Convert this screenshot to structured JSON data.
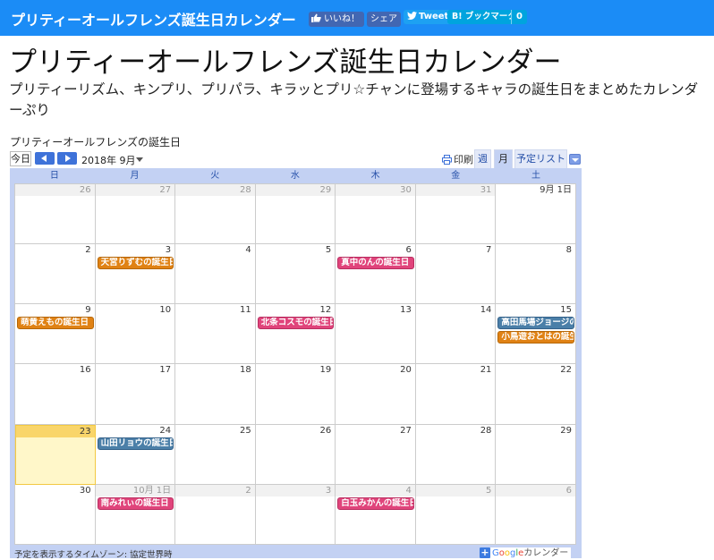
{
  "topbar": {
    "site_title": "プリティーオールフレンズ誕生日カレンダー",
    "like_label": "いいね！",
    "share_label": "シェア",
    "tweet_label": "Tweet",
    "hatena_label": "B! ブックマーク",
    "hatena_count": "0",
    "bar_color": "#1b8cf6"
  },
  "page": {
    "title": "プリティーオールフレンズ誕生日カレンダー",
    "description": "プリティーリズム、キンプリ、プリパラ、キラッとプリ☆チャンに登場するキャラの誕生日をまとめたカレンダーぷり"
  },
  "calendar": {
    "title": "プリティーオールフレンズの誕生日",
    "today_label": "今日",
    "month_label": "2018年 9月",
    "print_label": "印刷",
    "tabs": [
      "週",
      "月",
      "予定リスト"
    ],
    "weekdays": [
      "日",
      "月",
      "火",
      "水",
      "木",
      "金",
      "土"
    ],
    "weeks": [
      [
        {
          "label": "26",
          "other": true
        },
        {
          "label": "27",
          "other": true
        },
        {
          "label": "28",
          "other": true
        },
        {
          "label": "29",
          "other": true
        },
        {
          "label": "30",
          "other": true
        },
        {
          "label": "31",
          "other": true
        },
        {
          "label": "9月 1日",
          "other": false
        }
      ],
      [
        {
          "label": "2"
        },
        {
          "label": "3",
          "events": [
            {
              "title": "天宮りずむの誕生日",
              "color": "orange"
            }
          ]
        },
        {
          "label": "4"
        },
        {
          "label": "5"
        },
        {
          "label": "6",
          "events": [
            {
              "title": "真中のんの誕生日",
              "color": "pink"
            }
          ]
        },
        {
          "label": "7"
        },
        {
          "label": "8"
        }
      ],
      [
        {
          "label": "9",
          "events": [
            {
              "title": "萌黄えもの誕生日",
              "color": "orange"
            }
          ]
        },
        {
          "label": "10"
        },
        {
          "label": "11"
        },
        {
          "label": "12",
          "events": [
            {
              "title": "北条コスモの誕生日",
              "color": "pink"
            }
          ]
        },
        {
          "label": "13"
        },
        {
          "label": "14"
        },
        {
          "label": "15",
          "events": [
            {
              "title": "高田馬場ジョージの誕生日",
              "color": "slate"
            },
            {
              "title": "小鳥遊おとはの誕生日",
              "color": "orange"
            }
          ]
        }
      ],
      [
        {
          "label": "16"
        },
        {
          "label": "17"
        },
        {
          "label": "18"
        },
        {
          "label": "19"
        },
        {
          "label": "20"
        },
        {
          "label": "21"
        },
        {
          "label": "22"
        }
      ],
      [
        {
          "label": "23",
          "today": true
        },
        {
          "label": "24",
          "events": [
            {
              "title": "山田リョウの誕生日",
              "color": "slate"
            }
          ]
        },
        {
          "label": "25"
        },
        {
          "label": "26"
        },
        {
          "label": "27"
        },
        {
          "label": "28"
        },
        {
          "label": "29"
        }
      ],
      [
        {
          "label": "30"
        },
        {
          "label": "10月 1日",
          "other": true,
          "events": [
            {
              "title": "南みれぃの誕生日",
              "color": "pink"
            }
          ]
        },
        {
          "label": "2",
          "other": true
        },
        {
          "label": "3",
          "other": true
        },
        {
          "label": "4",
          "other": true,
          "events": [
            {
              "title": "白玉みかんの誕生日",
              "color": "pink"
            }
          ]
        },
        {
          "label": "5",
          "other": true
        },
        {
          "label": "6",
          "other": true
        }
      ]
    ],
    "timezone_label": "予定を表示するタイムゾーン: 協定世界時",
    "google_word": "Google",
    "calendar_word": "カレンダー",
    "colors": {
      "orange": "#e08214",
      "pink": "#e0447b",
      "slate": "#4b7fa8",
      "today": "#fff7c9"
    }
  }
}
